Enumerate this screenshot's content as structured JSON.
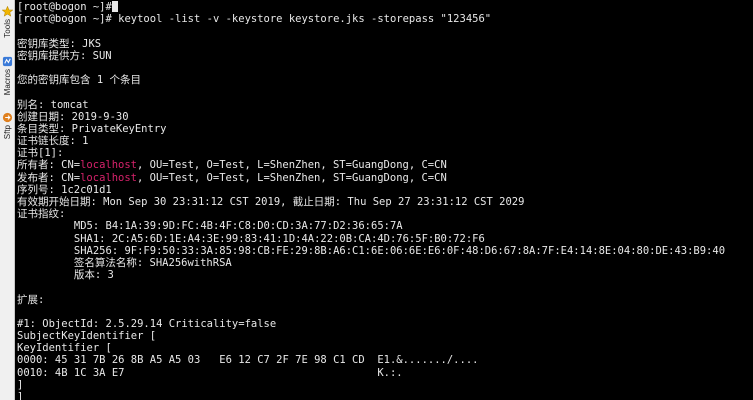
{
  "sidebar": {
    "items": [
      {
        "label": "Tools",
        "icon": "star-icon",
        "color": "#f2b600"
      },
      {
        "label": "Macros",
        "icon": "macro-icon",
        "color": "#3a7ad8"
      },
      {
        "label": "Sftp",
        "icon": "sftp-icon",
        "color": "#e0801e"
      }
    ]
  },
  "terminal": {
    "text_color": "#e8e8e8",
    "highlight_color": "#d6226b",
    "lines": [
      "[root@bogon ~]#",
      "[root@bogon ~]# keytool -list -v -keystore keystore.jks -storepass \"123456\"",
      "",
      "密钥库类型: JKS",
      "密钥库提供方: SUN",
      "",
      "您的密钥库包含 1 个条目",
      "",
      "别名: tomcat",
      "创建日期: 2019-9-30",
      "条目类型: PrivateKeyEntry",
      "证书链长度: 1",
      "证书[1]:",
      "所有者: CN=localhost, OU=Test, O=Test, L=ShenZhen, ST=GuangDong, C=CN",
      "发布者: CN=localhost, OU=Test, O=Test, L=ShenZhen, ST=GuangDong, C=CN",
      "序列号: 1c2c01d1",
      "有效期开始日期: Mon Sep 30 23:31:12 CST 2019, 截止日期: Thu Sep 27 23:31:12 CST 2029",
      "证书指纹:",
      "         MD5: B4:1A:39:9D:FC:4B:4F:C8:D0:CD:3A:77:D2:36:65:7A",
      "         SHA1: 2C:A5:6D:1E:A4:3E:99:83:41:1D:4A:22:0B:CA:4D:76:5F:B0:72:F6",
      "         SHA256: 9F:F9:50:33:3A:85:98:CB:FE:29:8B:A6:C1:6E:06:6E:E6:0F:48:D6:67:8A:7F:E4:14:8E:04:80:DE:43:B9:40",
      "         签名算法名称: SHA256withRSA",
      "         版本: 3",
      "",
      "扩展:",
      "",
      "#1: ObjectId: 2.5.29.14 Criticality=false",
      "SubjectKeyIdentifier [",
      "KeyIdentifier [",
      "0000: 45 31 7B 26 8B A5 A5 03   E6 12 C7 2F 7E 98 C1 CD  E1.&......./....",
      "0010: 4B 1C 3A E7                                        K.:.",
      "]",
      "]"
    ],
    "highlight_word": "localhost"
  }
}
